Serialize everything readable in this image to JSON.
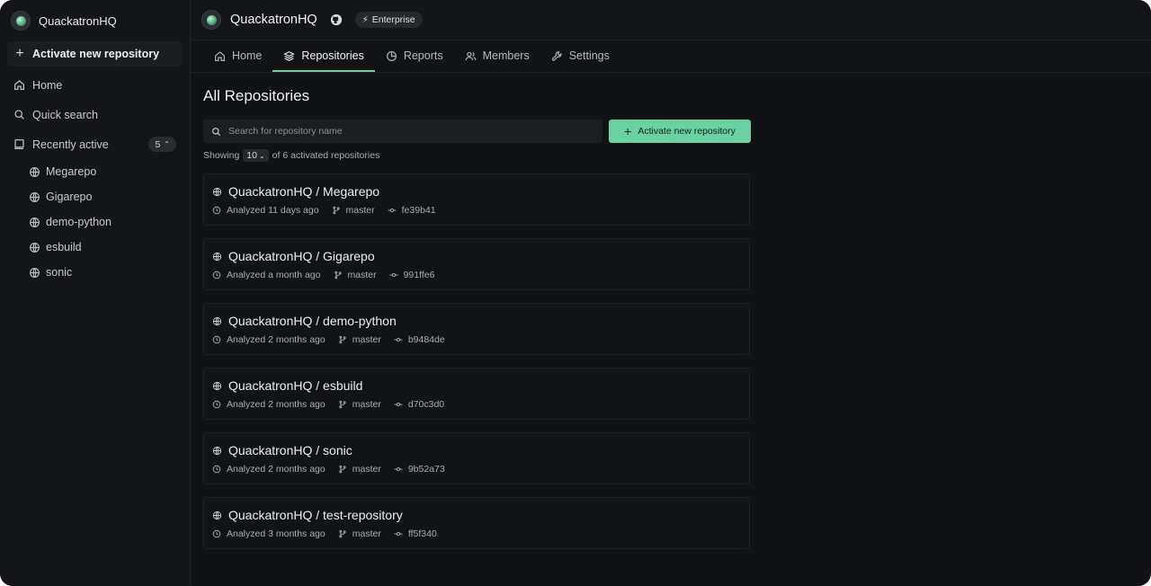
{
  "sidebar": {
    "org_name": "QuackatronHQ",
    "activate_label": "Activate new repository",
    "home_label": "Home",
    "quick_search_label": "Quick search",
    "recently_active_label": "Recently active",
    "recent_count": "5",
    "recent_items": [
      {
        "label": "Megarepo"
      },
      {
        "label": "Gigarepo"
      },
      {
        "label": "demo-python"
      },
      {
        "label": "esbuild"
      },
      {
        "label": "sonic"
      }
    ]
  },
  "header": {
    "title": "QuackatronHQ",
    "plan_badge": "Enterprise"
  },
  "tabs": [
    {
      "label": "Home",
      "icon": "home-icon"
    },
    {
      "label": "Repositories",
      "icon": "layers-icon",
      "active": true
    },
    {
      "label": "Reports",
      "icon": "pie-chart-icon"
    },
    {
      "label": "Members",
      "icon": "users-icon"
    },
    {
      "label": "Settings",
      "icon": "wrench-icon"
    }
  ],
  "main": {
    "title": "All Repositories",
    "search_placeholder": "Search for repository name",
    "activate_button": "Activate new repository",
    "showing_prefix": "Showing",
    "page_size": "10",
    "showing_suffix": "of 6 activated repositories"
  },
  "repos": [
    {
      "name": "QuackatronHQ / Megarepo",
      "analyzed": "Analyzed 11 days ago",
      "branch": "master",
      "commit": "fe39b41"
    },
    {
      "name": "QuackatronHQ / Gigarepo",
      "analyzed": "Analyzed a month ago",
      "branch": "master",
      "commit": "991ffe6"
    },
    {
      "name": "QuackatronHQ / demo-python",
      "analyzed": "Analyzed 2 months ago",
      "branch": "master",
      "commit": "b9484de"
    },
    {
      "name": "QuackatronHQ / esbuild",
      "analyzed": "Analyzed 2 months ago",
      "branch": "master",
      "commit": "d70c3d0"
    },
    {
      "name": "QuackatronHQ / sonic",
      "analyzed": "Analyzed 2 months ago",
      "branch": "master",
      "commit": "9b52a73"
    },
    {
      "name": "QuackatronHQ / test-repository",
      "analyzed": "Analyzed 3 months ago",
      "branch": "master",
      "commit": "ff5f340"
    }
  ],
  "colors": {
    "accent": "#6ad2a2",
    "background": "#111215",
    "sidebar": "#141518"
  }
}
